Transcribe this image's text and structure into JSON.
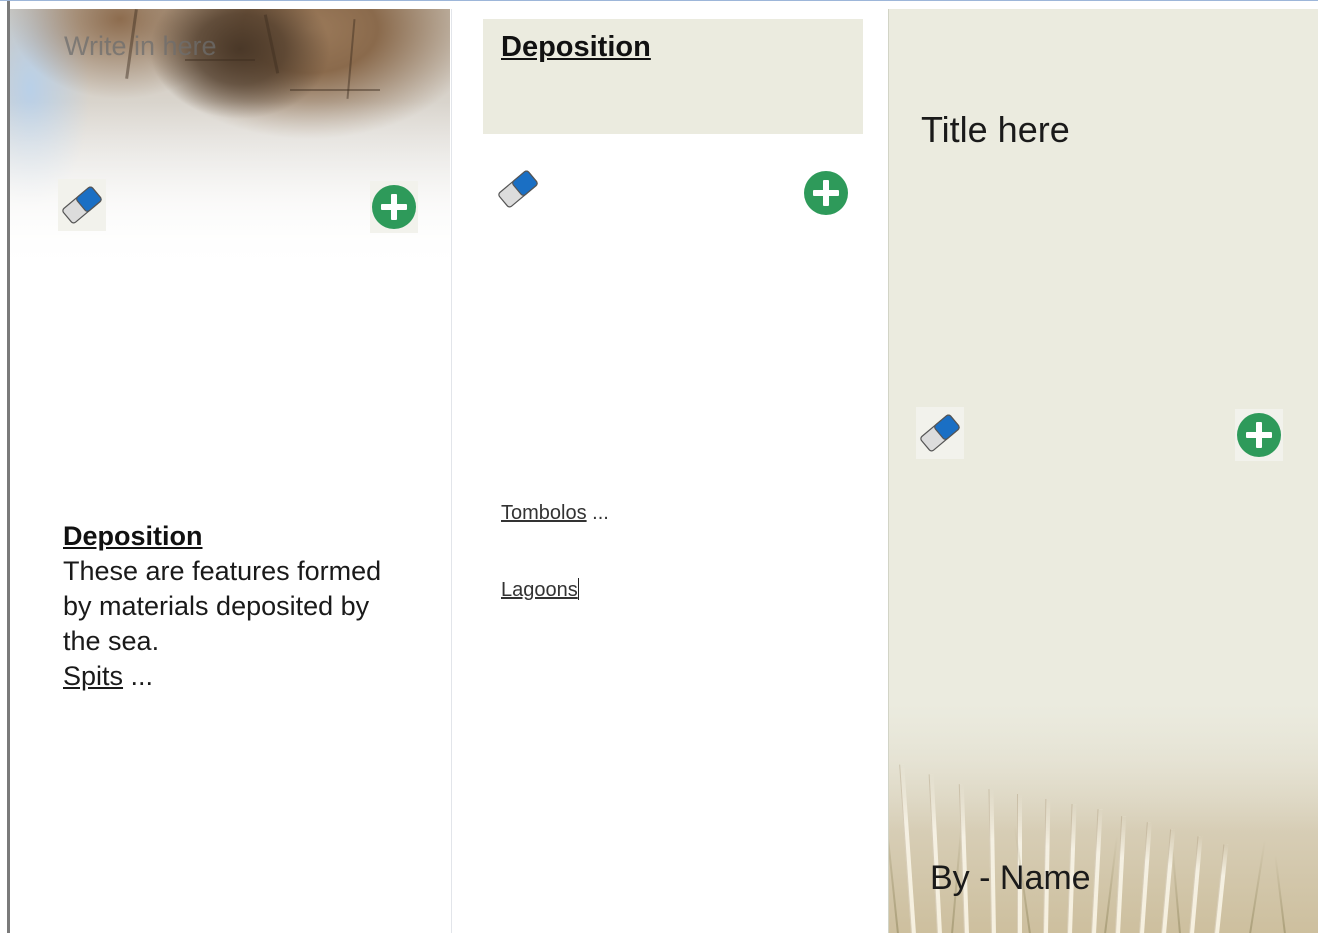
{
  "panel_left": {
    "watermark_text": "Write in here",
    "heading": "Deposition",
    "body_text": "These are features formed by materials deposited by the sea.",
    "link_label": "Spits",
    "ellipsis": "..."
  },
  "panel_middle": {
    "title": "Deposition",
    "links": [
      {
        "label": "Tombolos",
        "suffix": "..."
      },
      {
        "label": "Lagoons",
        "suffix": ""
      }
    ]
  },
  "panel_right": {
    "title": "Title here",
    "author": "By - Name"
  },
  "icons": {
    "eraser": "eraser-icon",
    "add": "add-circle-icon"
  },
  "colors": {
    "panel_background": "#ebebdf",
    "add_button": "#2e9a5a",
    "eraser_blue": "#1a6fc4"
  }
}
